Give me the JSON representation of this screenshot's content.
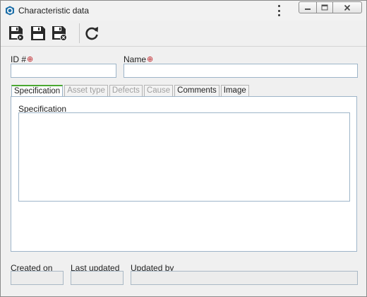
{
  "window": {
    "title": "Characteristic data"
  },
  "toolbar": {
    "buttons": [
      {
        "icon": "save-new-icon"
      },
      {
        "icon": "save-icon"
      },
      {
        "icon": "save-close-icon"
      },
      {
        "icon": "refresh-icon"
      }
    ]
  },
  "form": {
    "id_label": "ID #",
    "id_value": "",
    "name_label": "Name",
    "name_value": "",
    "required_marker": "⊕"
  },
  "tabs": [
    {
      "label": "Specification",
      "state": "active"
    },
    {
      "label": "Asset type",
      "state": "disabled"
    },
    {
      "label": "Defects",
      "state": "disabled"
    },
    {
      "label": "Cause",
      "state": "disabled"
    },
    {
      "label": "Comments",
      "state": "enabled"
    },
    {
      "label": "Image",
      "state": "enabled"
    }
  ],
  "specification": {
    "label": "Specification",
    "value": ""
  },
  "footer": {
    "created_on_label": "Created on",
    "created_on_value": "",
    "last_updated_label": "Last updated",
    "last_updated_value": "",
    "updated_by_label": "Updated by",
    "updated_by_value": ""
  },
  "colors": {
    "accent": "#1e6fa8",
    "required": "#c0282d",
    "active_tab_underline": "#4aa832",
    "field_border": "#9eb5c9"
  }
}
